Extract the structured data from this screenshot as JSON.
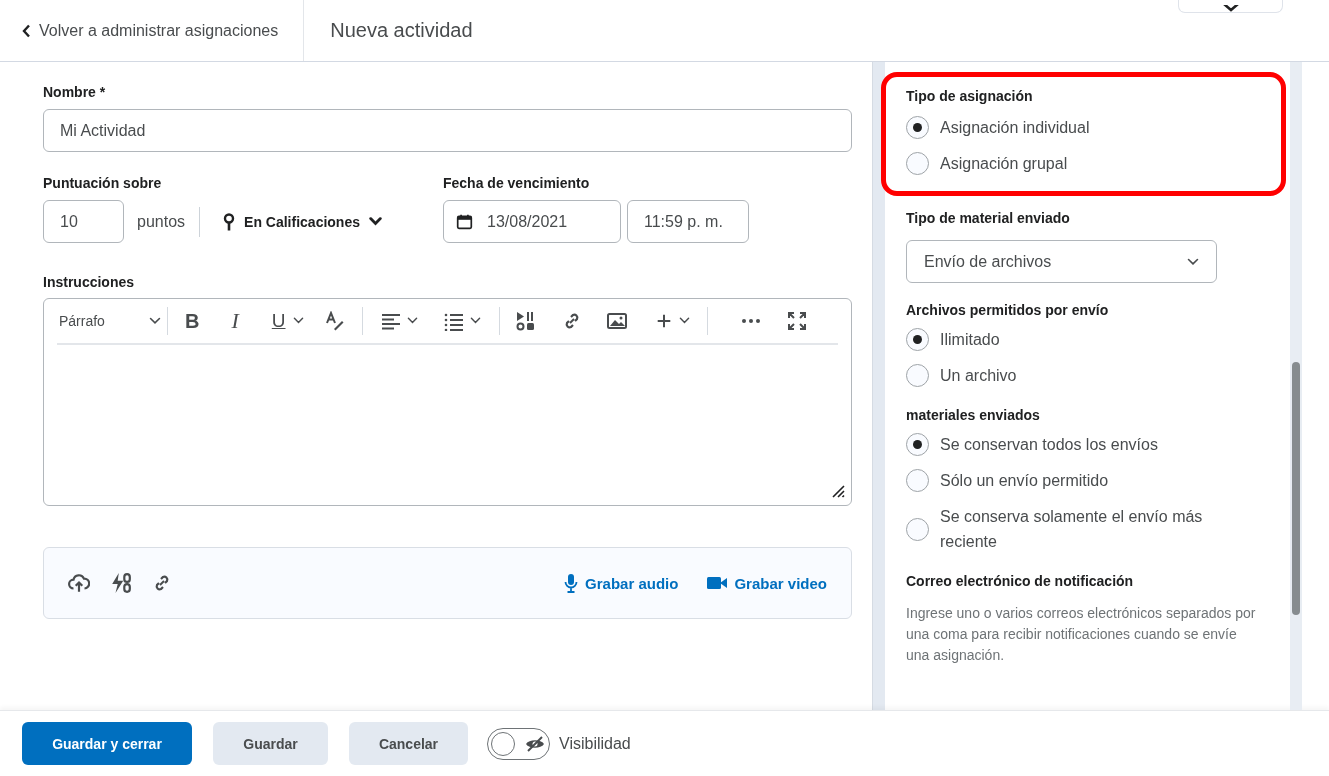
{
  "header": {
    "back_link": "Volver a administrar asignaciones",
    "title": "Nueva actividad"
  },
  "form": {
    "name": {
      "label": "Nombre",
      "required_mark": "*",
      "value": "Mi Actividad"
    },
    "score": {
      "label": "Puntuación sobre",
      "value": "10",
      "unit": "puntos",
      "grades_menu": "En Calificaciones"
    },
    "due": {
      "label": "Fecha de vencimiento",
      "date": "13/08/2021",
      "time": "11:59 p. m."
    },
    "instructions": {
      "label": "Instrucciones",
      "format_menu": "Párrafo",
      "bold_button": "B",
      "italic_button": "I",
      "underline_button": "U"
    },
    "attachments": {
      "record_audio": "Grabar audio",
      "record_video": "Grabar video"
    }
  },
  "panel": {
    "sections": [
      {
        "kind": "radio",
        "title": "Tipo de asignación",
        "highlighted": true,
        "options": [
          {
            "label": "Asignación individual",
            "selected": true
          },
          {
            "label": "Asignación grupal",
            "selected": false
          }
        ]
      },
      {
        "kind": "select",
        "title": "Tipo de material enviado",
        "value": "Envío de archivos"
      },
      {
        "kind": "radio",
        "title": "Archivos permitidos por envío",
        "highlighted": false,
        "options": [
          {
            "label": "Ilimitado",
            "selected": true
          },
          {
            "label": "Un archivo",
            "selected": false
          }
        ]
      },
      {
        "kind": "radio",
        "title": "materiales enviados",
        "highlighted": false,
        "options": [
          {
            "label": "Se conservan todos los envíos",
            "selected": true
          },
          {
            "label": "Sólo un envío permitido",
            "selected": false
          },
          {
            "label": "Se conserva solamente el envío más reciente",
            "selected": false
          }
        ]
      },
      {
        "kind": "note",
        "title": "Correo electrónico de notificación",
        "text": "Ingrese uno o varios correos electrónicos separados por una coma para recibir notificaciones cuando se envíe una asignación."
      }
    ]
  },
  "footer": {
    "buttons": [
      {
        "label": "Guardar y cerrar",
        "primary": true
      },
      {
        "label": "Guardar",
        "primary": false
      },
      {
        "label": "Cancelar",
        "primary": false
      }
    ],
    "visibility": {
      "label": "Visibilidad",
      "on": false
    }
  }
}
